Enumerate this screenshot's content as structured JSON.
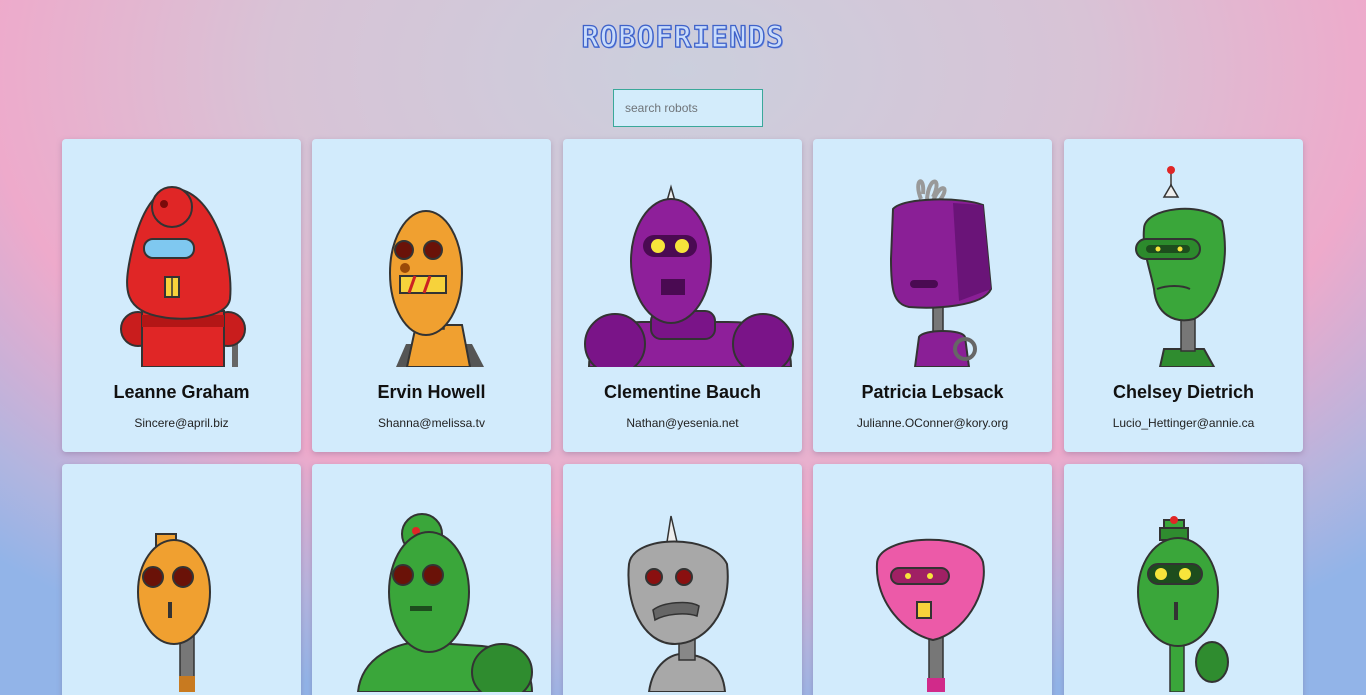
{
  "app": {
    "title": "ROBOFRIENDS"
  },
  "search": {
    "placeholder": "search robots",
    "value": ""
  },
  "robots": [
    {
      "name": "Leanne Graham",
      "email": "Sincere@april.biz",
      "color": "#e02626",
      "icon": "red-robot"
    },
    {
      "name": "Ervin Howell",
      "email": "Shanna@melissa.tv",
      "color": "#f0a030",
      "icon": "orange-robot"
    },
    {
      "name": "Clementine Bauch",
      "email": "Nathan@yesenia.net",
      "color": "#8e1f9a",
      "icon": "purple-robot"
    },
    {
      "name": "Patricia Lebsack",
      "email": "Julianne.OConner@kory.org",
      "color": "#8a1f96",
      "icon": "purple-robot"
    },
    {
      "name": "Chelsey Dietrich",
      "email": "Lucio_Hettinger@annie.ca",
      "color": "#3aa63a",
      "icon": "green-robot"
    },
    {
      "name": "",
      "email": "",
      "color": "#f0a030",
      "icon": "orange-robot"
    },
    {
      "name": "",
      "email": "",
      "color": "#3aa63a",
      "icon": "green-robot"
    },
    {
      "name": "",
      "email": "",
      "color": "#a8a8a8",
      "icon": "gray-robot"
    },
    {
      "name": "",
      "email": "",
      "color": "#ec5aa8",
      "icon": "pink-robot"
    },
    {
      "name": "",
      "email": "",
      "color": "#3aa63a",
      "icon": "green-robot"
    }
  ]
}
